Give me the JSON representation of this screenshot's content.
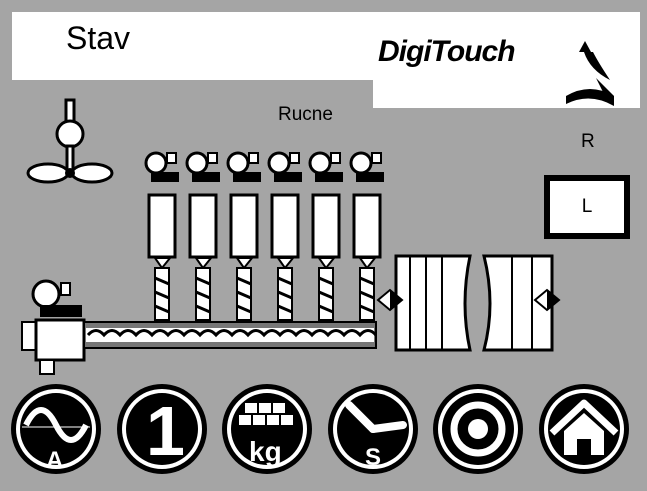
{
  "header": {
    "title": "Stav",
    "logo": "DigiTouch"
  },
  "status": {
    "mode": "Rucne",
    "right_label": "R",
    "side_button": "L"
  },
  "icons": {
    "fan": "fan-icon",
    "dosing_units": 6,
    "bottom_buttons": [
      "current-sine-A-icon",
      "number-1-icon",
      "weight-kg-icon",
      "timer-s-icon",
      "target-icon",
      "home-icon"
    ]
  },
  "bottom": {
    "number_label": "1",
    "kg_label": "kg",
    "a_label": "A",
    "s_label": "S"
  },
  "colors": {
    "background": "#a5a5a5",
    "panel": "#ffffff",
    "foreground": "#000000"
  }
}
